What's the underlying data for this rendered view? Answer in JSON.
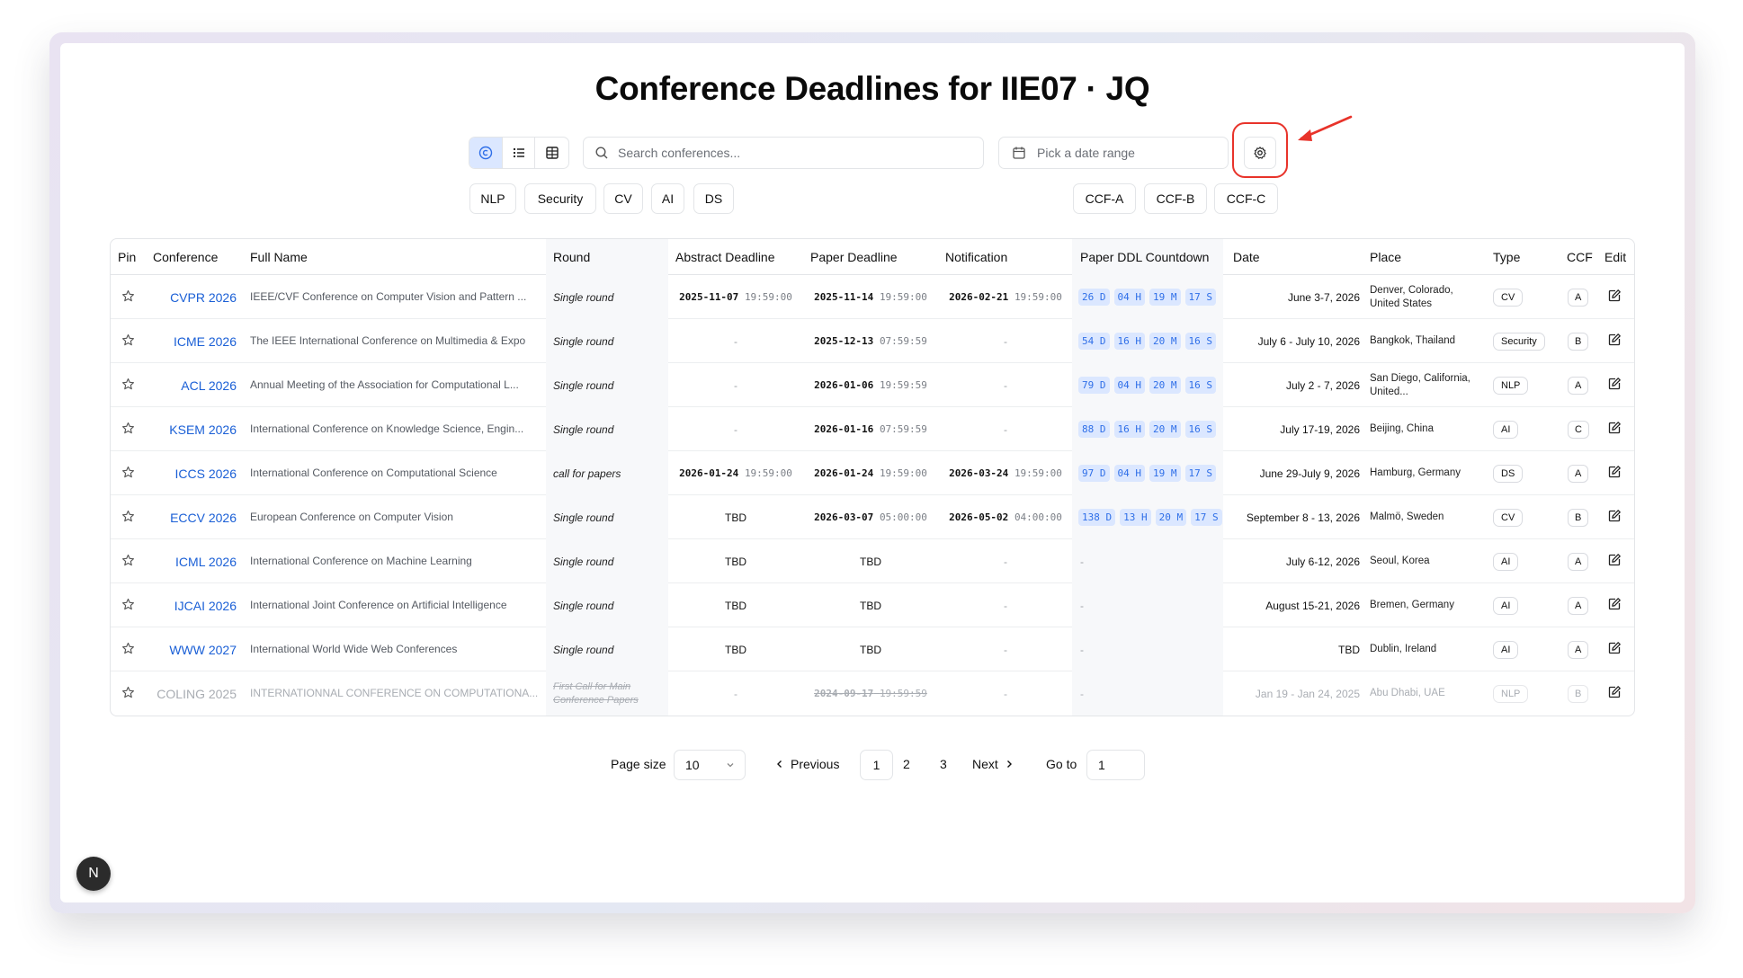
{
  "title": "Conference Deadlines for IIE07 · JQ",
  "toolbar": {
    "search_placeholder": "Search conferences...",
    "date_placeholder": "Pick a date range"
  },
  "filters": {
    "topics": [
      "NLP",
      "Security",
      "CV",
      "AI",
      "DS"
    ],
    "ccf": [
      "CCF-A",
      "CCF-B",
      "CCF-C"
    ]
  },
  "table": {
    "headers": {
      "pin": "Pin",
      "conference": "Conference",
      "full_name": "Full Name",
      "round": "Round",
      "abstract": "Abstract Deadline",
      "paper": "Paper Deadline",
      "notification": "Notification",
      "countdown": "Paper DDL Countdown",
      "date": "Date",
      "place": "Place",
      "type": "Type",
      "ccf": "CCF",
      "edit": "Edit"
    },
    "rows": [
      {
        "conference": "CVPR 2026",
        "full_name": "IEEE/CVF Conference on Computer Vision and Pattern ...",
        "round": "Single round",
        "abstract": {
          "date": "2025-11-07",
          "time": "19:59:00"
        },
        "paper": {
          "date": "2025-11-14",
          "time": "19:59:00"
        },
        "notification": {
          "date": "2026-02-21",
          "time": "19:59:00"
        },
        "countdown": [
          "26 D",
          "04 H",
          "19 M",
          "17 S"
        ],
        "date": "June 3-7, 2026",
        "place": "Denver, Colorado, United States",
        "type": "CV",
        "ccf": "A"
      },
      {
        "conference": "ICME 2026",
        "full_name": "The IEEE International Conference on Multimedia & Expo",
        "round": "Single round",
        "abstract": {
          "text": "-"
        },
        "paper": {
          "date": "2025-12-13",
          "time": "07:59:59"
        },
        "notification": {
          "text": "-"
        },
        "countdown": [
          "54 D",
          "16 H",
          "20 M",
          "16 S"
        ],
        "date": "July 6 - July 10, 2026",
        "place": "Bangkok, Thailand",
        "type": "Security",
        "ccf": "B"
      },
      {
        "conference": "ACL 2026",
        "full_name": "Annual Meeting of the Association for Computational L...",
        "round": "Single round",
        "abstract": {
          "text": "-"
        },
        "paper": {
          "date": "2026-01-06",
          "time": "19:59:59"
        },
        "notification": {
          "text": "-"
        },
        "countdown": [
          "79 D",
          "04 H",
          "20 M",
          "16 S"
        ],
        "date": "July 2 - 7, 2026",
        "place": "San Diego, California, United...",
        "type": "NLP",
        "ccf": "A"
      },
      {
        "conference": "KSEM 2026",
        "full_name": "International Conference on Knowledge Science, Engin...",
        "round": "Single round",
        "abstract": {
          "text": "-"
        },
        "paper": {
          "date": "2026-01-16",
          "time": "07:59:59"
        },
        "notification": {
          "text": "-"
        },
        "countdown": [
          "88 D",
          "16 H",
          "20 M",
          "16 S"
        ],
        "date": "July 17-19, 2026",
        "place": "Beijing, China",
        "type": "AI",
        "ccf": "C"
      },
      {
        "conference": "ICCS 2026",
        "full_name": "International Conference on Computational Science",
        "round": "call for papers",
        "abstract": {
          "date": "2026-01-24",
          "time": "19:59:00"
        },
        "paper": {
          "date": "2026-01-24",
          "time": "19:59:00"
        },
        "notification": {
          "date": "2026-03-24",
          "time": "19:59:00"
        },
        "countdown": [
          "97 D",
          "04 H",
          "19 M",
          "17 S"
        ],
        "date": "June 29-July 9, 2026",
        "place": "Hamburg, Germany",
        "type": "DS",
        "ccf": "A"
      },
      {
        "conference": "ECCV 2026",
        "full_name": "European Conference on Computer Vision",
        "round": "Single round",
        "abstract": {
          "text": "TBD"
        },
        "paper": {
          "date": "2026-03-07",
          "time": "05:00:00"
        },
        "notification": {
          "date": "2026-05-02",
          "time": "04:00:00"
        },
        "countdown": [
          "138 D",
          "13 H",
          "20 M",
          "17 S"
        ],
        "date": "September 8 - 13, 2026",
        "place": "Malmö, Sweden",
        "type": "CV",
        "ccf": "B"
      },
      {
        "conference": "ICML 2026",
        "full_name": "International Conference on Machine Learning",
        "round": "Single round",
        "abstract": {
          "text": "TBD"
        },
        "paper": {
          "text": "TBD"
        },
        "notification": {
          "text": "-"
        },
        "countdown_text": "-",
        "date": "July 6-12, 2026",
        "place": "Seoul, Korea",
        "type": "AI",
        "ccf": "A"
      },
      {
        "conference": "IJCAI 2026",
        "full_name": "International Joint Conference on Artificial Intelligence",
        "round": "Single round",
        "abstract": {
          "text": "TBD"
        },
        "paper": {
          "text": "TBD"
        },
        "notification": {
          "text": "-"
        },
        "countdown_text": "-",
        "date": "August 15-21, 2026",
        "place": "Bremen, Germany",
        "type": "AI",
        "ccf": "A"
      },
      {
        "conference": "WWW 2027",
        "full_name": "International World Wide Web Conferences",
        "round": "Single round",
        "abstract": {
          "text": "TBD"
        },
        "paper": {
          "text": "TBD"
        },
        "notification": {
          "text": "-"
        },
        "countdown_text": "-",
        "date": "TBD",
        "place": "Dublin, Ireland",
        "type": "AI",
        "ccf": "A"
      },
      {
        "conference": "COLING 2025",
        "full_name": "INTERNATIONNAL CONFERENCE ON COMPUTATIONA...",
        "round": "First Call for Main Conference Papers",
        "abstract": {
          "text": "-"
        },
        "paper": {
          "date": "2024-09-17",
          "time": "19:59:59"
        },
        "notification": {
          "text": "-"
        },
        "countdown_text": "-",
        "date": "Jan 19 - Jan 24, 2025",
        "place": "Abu Dhabi, UAE",
        "type": "NLP",
        "ccf": "B",
        "expired": true
      }
    ]
  },
  "pagination": {
    "page_size_label": "Page size",
    "page_size_value": "10",
    "previous_label": "Previous",
    "pages": [
      "1",
      "2",
      "3"
    ],
    "next_label": "Next",
    "goto_label": "Go to",
    "goto_value": "1"
  },
  "dev_badge": "N",
  "colors": {
    "accent": "#2f6fe8",
    "accent_bg": "#dbe7ff",
    "link": "#1a5fd6",
    "annotation_red": "#e8332a"
  }
}
